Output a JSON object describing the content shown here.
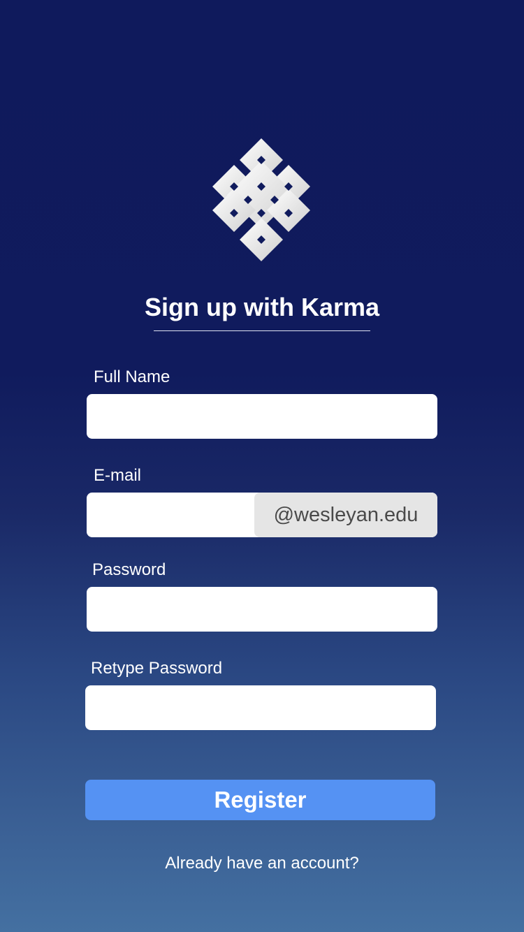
{
  "header": {
    "logo_icon": "endless-knot-icon",
    "title": "Sign up with Karma"
  },
  "form": {
    "full_name": {
      "label": "Full Name",
      "value": "",
      "placeholder": ""
    },
    "email": {
      "label": "E-mail",
      "value": "",
      "placeholder": "",
      "suffix": "@wesleyan.edu"
    },
    "password": {
      "label": "Password",
      "value": "",
      "placeholder": ""
    },
    "retype_password": {
      "label": "Retype Password",
      "value": "",
      "placeholder": ""
    },
    "register_label": "Register",
    "signin_link": "Already have an account?"
  },
  "colors": {
    "background_top": "#0f1a5c",
    "background_bottom": "#4470a1",
    "button": "#5592f3",
    "suffix_background": "#e5e5e5"
  }
}
